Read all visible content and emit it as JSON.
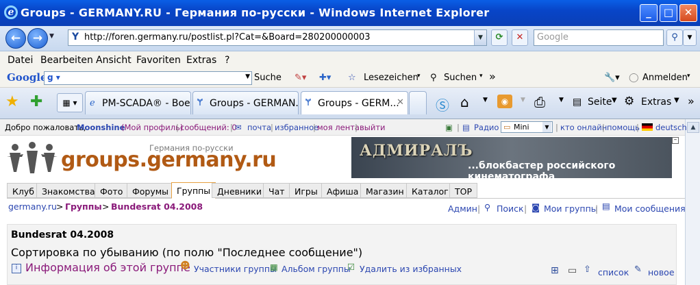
{
  "window": {
    "title": "Groups - GERMANY.RU - Германия по-русски - Windows Internet Explorer"
  },
  "address": {
    "url": "http://foren.germany.ru/postlist.pl?Cat=&Board=280200000003",
    "search_placeholder": "Google"
  },
  "menu": [
    "Datei",
    "Bearbeiten",
    "Ansicht",
    "Favoriten",
    "Extras",
    "?"
  ],
  "google_bar": {
    "logo": "Google",
    "search_label": "Suche",
    "bookmarks_label": "Lesezeichen",
    "find_label": "Suchen",
    "more": "»",
    "login_label": "Anmelden"
  },
  "tabs": [
    {
      "label": "PM-SCADA® - Boe..."
    },
    {
      "label": "Groups - GERMAN..."
    },
    {
      "label": "Groups - GERM..."
    }
  ],
  "commands": {
    "page": "Seite",
    "tools": "Extras",
    "more": "»"
  },
  "userbar": {
    "welcome": "Добро пожаловать,",
    "user": "Moonshine",
    "profile": "(Мой профиль)",
    "messages": "сообщений: 0",
    "mail": "почта",
    "favorites": "избранное",
    "feed": "моя лента",
    "logout": "выйти",
    "radio": "Радио",
    "player_mode": "Mini",
    "online": "кто онлайн",
    "help": "помощь",
    "language": "deutsch"
  },
  "site": {
    "logo": "groups.germany.ru",
    "slogan": "Германия по-русски"
  },
  "banner": {
    "title": "АДМИРАЛЪ",
    "subtitle": "...блокбастер российского кинематографа"
  },
  "navtabs": [
    "Клуб",
    "Знакомства",
    "Фото",
    "Форумы",
    "Группы",
    "Дневники",
    "Чат",
    "Игры",
    "Афиша",
    "Магазин",
    "Каталог",
    "TOP"
  ],
  "breadcrumb": {
    "home": "germany.ru",
    "sep": ">",
    "section": "Группы",
    "current": "Bundesrat 04.2008"
  },
  "right_links": {
    "admin": "Админ",
    "search": "Поиск",
    "my_groups": "Мои группы",
    "my_messages": "Мои сообщения"
  },
  "group": {
    "title": "Bundesrat 04.2008",
    "sort": "Сортировка по убыванию (по полю \"Последнее сообщение\")",
    "info": "Информация об этой группе",
    "members": "Участники группы",
    "album": "Альбом группы",
    "unfav": "Удалить из избранных",
    "list": "список",
    "new": "новое"
  },
  "colors": {
    "titlebar": "#0a4fd6",
    "link": "#2b46b0",
    "accent": "#b15a14",
    "active_tab_border": "#e6a040"
  }
}
